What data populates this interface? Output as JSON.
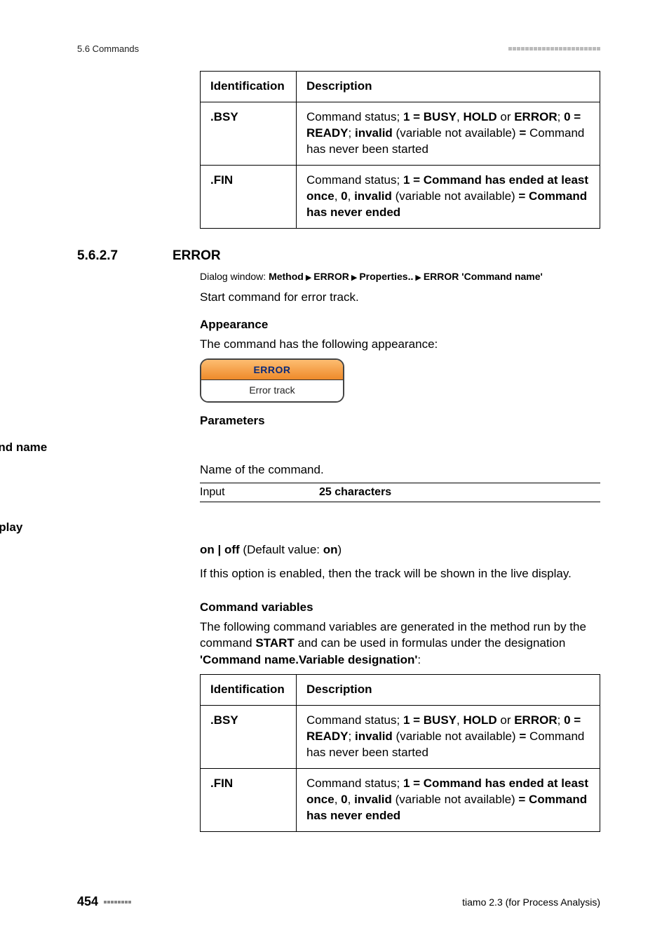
{
  "runhead_left": "5.6 Commands",
  "table1": {
    "h_id": "Identification",
    "h_desc": "Description",
    "rows": [
      {
        "id": ".BSY",
        "d_pre": "Command status; ",
        "d_b1": "1 = BUSY",
        "d_sep1": ", ",
        "d_b2": "HOLD",
        "d_sep2": " or ",
        "d_b3": "ERROR",
        "d_sep3": "; ",
        "d_b4": "0 = READY",
        "d_sep4": "; ",
        "d_b5": "invalid",
        "d_mid": " (variable not available) ",
        "d_b6": "=",
        "d_tail": " Command has never been started"
      },
      {
        "id": ".FIN",
        "d_pre": "Command status; ",
        "d_b1": "1 = Command has ended at least once",
        "d_sep1": ", ",
        "d_b2": "0",
        "d_sep2": ", ",
        "d_b3": "invalid",
        "d_mid": " (variable not available) ",
        "d_b4": "= Command has never ended"
      }
    ]
  },
  "section": {
    "num": "5.6.2.7",
    "title": "ERROR"
  },
  "dialog": {
    "label": "Dialog window: ",
    "p1": "Method",
    "p2": "ERROR",
    "p3": "Properties..",
    "p4": "ERROR 'Command name'"
  },
  "intro_line": "Start command for error track.",
  "appearance": {
    "head": "Appearance",
    "text": "The command has the following appearance:",
    "widget_top": "ERROR",
    "widget_bottom": "Error track"
  },
  "parameters_head": "Parameters",
  "command_name": {
    "label": "Command name",
    "text": "Name of the command.",
    "input_label": "Input",
    "input_value": "25 characters"
  },
  "live_display": {
    "label": "Live display",
    "line_b1": "on | off",
    "line_mid": " (Default value: ",
    "line_b2": "on",
    "line_tail": ")",
    "body": "If this option is enabled, then the track will be shown in the live display."
  },
  "cmd_vars": {
    "head": "Command variables",
    "body_pre": "The following command variables are generated in the method run by the command ",
    "body_b": "START",
    "body_mid": " and can be used in formulas under the designation ",
    "body_b2": "'Command name.Variable designation'",
    "body_tail": ":"
  },
  "footer": {
    "page": "454",
    "product": "tiamo 2.3 (for Process Analysis)"
  }
}
